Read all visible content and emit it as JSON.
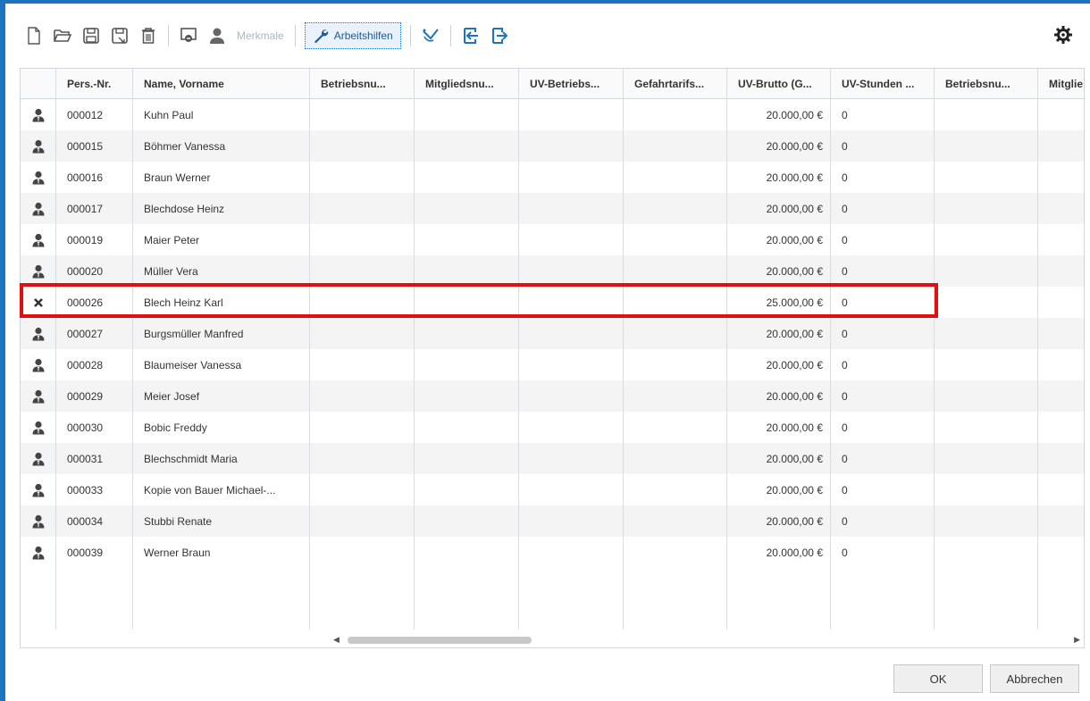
{
  "toolbar": {
    "merkmale_label": "Merkmale",
    "arbeitshilfen_label": "Arbeitshilfen"
  },
  "icons": {
    "new": "new-document-icon",
    "open": "open-folder-icon",
    "save": "save-icon",
    "save_as": "save-as-icon",
    "delete": "trash-icon",
    "device": "device-remove-icon",
    "person": "person-icon",
    "wrench": "wrench-icon",
    "reflex": "reflex-hammer-icon",
    "import": "import-icon",
    "export": "export-icon",
    "settings": "gear-icon"
  },
  "table": {
    "columns": [
      "",
      "Pers.-Nr.",
      "Name, Vorname",
      "Betriebsnu...",
      "Mitgliedsnu...",
      "UV-Betriebs...",
      "Gefahrtarifs...",
      "UV-Brutto (G...",
      "UV-Stunden ...",
      "Betriebsnu...",
      "Mitglie"
    ],
    "rows": [
      {
        "status": "person",
        "nr": "000012",
        "name": "Kuhn Paul",
        "brutto": "20.000,00 €",
        "stunden": "0"
      },
      {
        "status": "person",
        "nr": "000015",
        "name": "Böhmer Vanessa",
        "brutto": "20.000,00 €",
        "stunden": "0"
      },
      {
        "status": "person",
        "nr": "000016",
        "name": "Braun Werner",
        "brutto": "20.000,00 €",
        "stunden": "0"
      },
      {
        "status": "person",
        "nr": "000017",
        "name": "Blechdose Heinz",
        "brutto": "20.000,00 €",
        "stunden": "0"
      },
      {
        "status": "person",
        "nr": "000019",
        "name": "Maier Peter",
        "brutto": "20.000,00 €",
        "stunden": "0"
      },
      {
        "status": "person",
        "nr": "000020",
        "name": "Müller Vera",
        "brutto": "20.000,00 €",
        "stunden": "0"
      },
      {
        "status": "x",
        "nr": "000026",
        "name": "Blech Heinz Karl",
        "brutto": "25.000,00 €",
        "stunden": "0"
      },
      {
        "status": "person",
        "nr": "000027",
        "name": "Burgsmüller Manfred",
        "brutto": "20.000,00 €",
        "stunden": "0"
      },
      {
        "status": "person",
        "nr": "000028",
        "name": "Blaumeiser Vanessa",
        "brutto": "20.000,00 €",
        "stunden": "0"
      },
      {
        "status": "person",
        "nr": "000029",
        "name": "Meier Josef",
        "brutto": "20.000,00 €",
        "stunden": "0"
      },
      {
        "status": "person",
        "nr": "000030",
        "name": "Bobic Freddy",
        "brutto": "20.000,00 €",
        "stunden": "0"
      },
      {
        "status": "person",
        "nr": "000031",
        "name": "Blechschmidt Maria",
        "brutto": "20.000,00 €",
        "stunden": "0"
      },
      {
        "status": "person",
        "nr": "000033",
        "name": "Kopie von Bauer Michael-...",
        "brutto": "20.000,00 €",
        "stunden": "0"
      },
      {
        "status": "person",
        "nr": "000034",
        "name": "Stubbi Renate",
        "brutto": "20.000,00 €",
        "stunden": "0"
      },
      {
        "status": "person",
        "nr": "000039",
        "name": "Werner Braun",
        "brutto": "20.000,00 €",
        "stunden": "0"
      }
    ]
  },
  "buttons": {
    "ok": "OK",
    "cancel": "Abbrechen"
  },
  "colors": {
    "accent": "#1e73be",
    "highlight": "#e01010"
  }
}
